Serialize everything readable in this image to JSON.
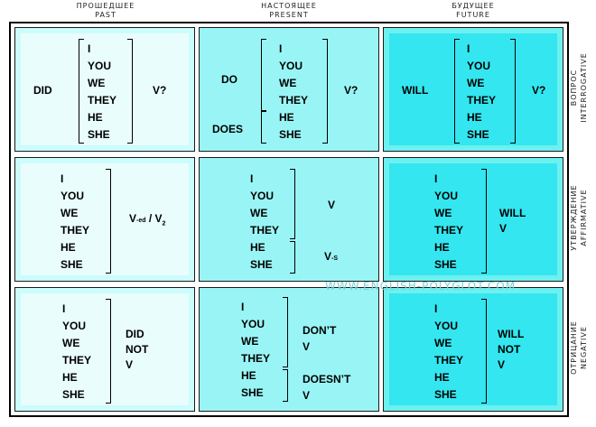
{
  "columns": [
    {
      "ru": "ПРОШЕДШЕЕ",
      "en": "PAST"
    },
    {
      "ru": "НАСТОЯЩЕЕ",
      "en": "PRESENT"
    },
    {
      "ru": "БУДУЩЕЕ",
      "en": "FUTURE"
    }
  ],
  "rows": [
    {
      "ru": "ВОПРОС",
      "en": "INTERROGATIVE"
    },
    {
      "ru": "УТВЕРЖДЕНИЕ",
      "en": "AFFIRMATIVE"
    },
    {
      "ru": "ОТРИЦАНИЕ",
      "en": "NEGATIVE"
    }
  ],
  "pronouns": [
    "I",
    "YOU",
    "WE",
    "THEY",
    "HE",
    "SHE"
  ],
  "cells": {
    "past_interrogative": {
      "aux": "DID",
      "verb": "V?"
    },
    "present_interrogative": {
      "aux_plural": "DO",
      "aux_singular": "DOES",
      "verb": "V?"
    },
    "future_interrogative": {
      "aux": "WILL",
      "verb": "V?"
    },
    "past_affirmative": {
      "verb_main": "V",
      "verb_sub1": "-ed",
      "verb_sep": " / V",
      "verb_sub2": "2"
    },
    "present_affirmative": {
      "verb_plural": "V",
      "verb_singular_main": "V",
      "verb_singular_sub": "-S"
    },
    "future_affirmative": {
      "line1": "WILL",
      "line2": "V"
    },
    "past_negative": {
      "line1": "DID",
      "line2": "NOT",
      "line3": "V"
    },
    "present_negative": {
      "plural_line1": "DON’T",
      "plural_line2": "V",
      "singular_line1": "DOESN’T",
      "singular_line2": "V"
    },
    "future_negative": {
      "line1": "WILL",
      "line2": "NOT",
      "line3": "V"
    }
  },
  "watermark": "WWW.ENGLISH-POLYGLOT.COM"
}
